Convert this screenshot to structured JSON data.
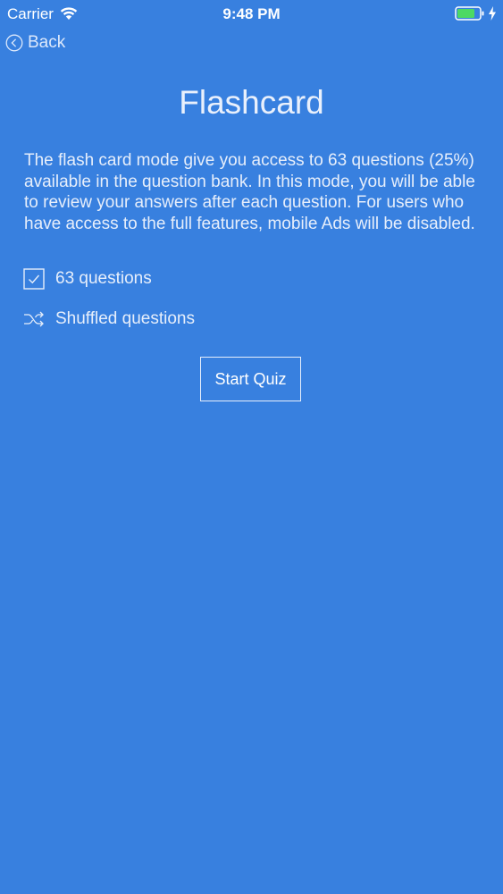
{
  "status_bar": {
    "carrier": "Carrier",
    "time": "9:48 PM",
    "battery_color": "#4cd964"
  },
  "nav": {
    "back_label": "Back",
    "back_icon": "chevron-left-circle-icon"
  },
  "main": {
    "title": "Flashcard",
    "description": "The flash card mode give you access to 63 questions (25%) available in the question bank. In this mode, you will be able to review your answers after each question. For users who have access to the full features, mobile Ads will be disabled.",
    "options": [
      {
        "label": "63 questions",
        "icon": "checkbox-checked-icon",
        "checked": true
      },
      {
        "label": "Shuffled questions",
        "icon": "shuffle-icon"
      }
    ],
    "start_button_label": "Start Quiz"
  },
  "colors": {
    "background": "#3880df",
    "text": "#ffffff"
  }
}
